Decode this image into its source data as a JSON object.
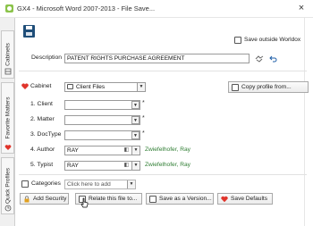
{
  "window": {
    "title": "GX4 - Microsoft Word 2007-2013 - File Save...",
    "close_glyph": "×"
  },
  "sidebar": {
    "tabs": [
      {
        "label": "Cabinets",
        "icon": "cabinet-icon"
      },
      {
        "label": "Favorite Matters",
        "icon": "heart-icon"
      },
      {
        "label": "Quick Profiles",
        "icon": "clock-icon"
      }
    ]
  },
  "toolbar": {
    "save_outside_label": "Save outside Worldox"
  },
  "form": {
    "description_label": "Description",
    "description_value": "PATENT RIGHTS PURCHASE AGREEMENT",
    "cabinet_label": "Cabinet",
    "cabinet_value": "Client Files",
    "copy_profile_label": "Copy profile from...",
    "fields": [
      {
        "label": "1. Client",
        "value": "",
        "required": "*",
        "desc": ""
      },
      {
        "label": "2. Matter",
        "value": "",
        "required": "*",
        "desc": ""
      },
      {
        "label": "3. DocType",
        "value": "",
        "required": "*",
        "desc": ""
      },
      {
        "label": "4. Author",
        "value": "RAY",
        "required": "",
        "desc": "Zwiefelhofer, Ray"
      },
      {
        "label": "5. Typist",
        "value": "RAY",
        "required": "",
        "desc": "Zwiefelhofer, Ray"
      }
    ],
    "categories_label": "Categories",
    "categories_placeholder": "Click here to add"
  },
  "buttons": {
    "add_security": "Add Security",
    "relate": "Relate this file to...",
    "save_as_version": "Save as a Version...",
    "save_defaults": "Save Defaults"
  },
  "colors": {
    "accent_red": "#e0342b",
    "link_green": "#2e7d32",
    "save_blue": "#1f4e79"
  }
}
